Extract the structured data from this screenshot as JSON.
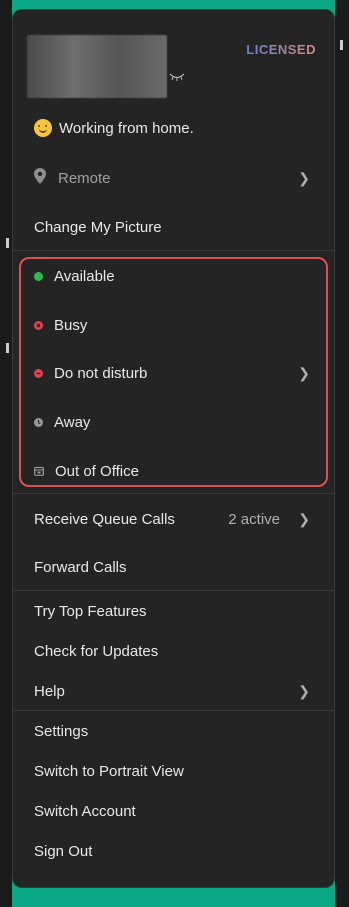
{
  "profile": {
    "badge": "LICENSED"
  },
  "status_message": "Working from home.",
  "location": {
    "label": "Remote"
  },
  "change_picture": "Change My Picture",
  "statuses": [
    {
      "label": "Available",
      "color": "#2fb84f",
      "icon": "available-dot-icon"
    },
    {
      "label": "Busy",
      "color": "#e0424e",
      "icon": "busy-x-icon"
    },
    {
      "label": "Do not disturb",
      "color": "#e0424e",
      "icon": "dnd-minus-icon"
    },
    {
      "label": "Away",
      "color": "#9a9a9a",
      "icon": "away-clock-icon"
    },
    {
      "label": "Out of Office",
      "color": "#9a9a9a",
      "icon": "calendar-icon"
    }
  ],
  "queue": {
    "label": "Receive Queue Calls",
    "aux": "2 active"
  },
  "forward_calls": "Forward Calls",
  "menu": {
    "top_features": "Try Top Features",
    "check_updates": "Check for Updates",
    "help": "Help",
    "settings": "Settings",
    "portrait": "Switch to Portrait View",
    "switch_account": "Switch Account",
    "sign_out": "Sign Out"
  },
  "colors": {
    "accent_highlight": "#d9534f",
    "menu_bg": "#242424",
    "backdrop": "#0aa884"
  }
}
